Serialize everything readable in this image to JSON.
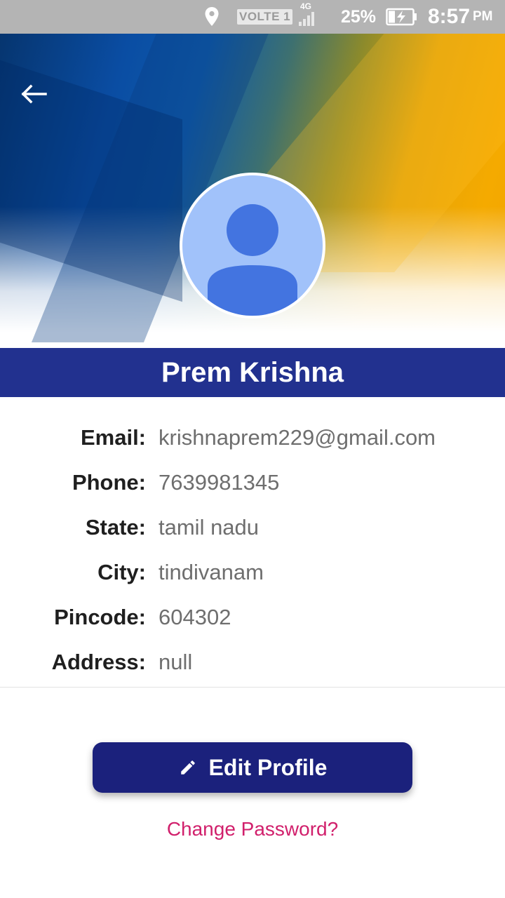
{
  "status_bar": {
    "network_badge": "VOLTE 1",
    "network_type": "4G",
    "battery_percent": "25%",
    "time": "8:57",
    "ampm": "PM"
  },
  "profile": {
    "name": "Prem Krishna"
  },
  "details": [
    {
      "label": "Email:",
      "value": "krishnaprem229@gmail.com"
    },
    {
      "label": "Phone:",
      "value": "7639981345"
    },
    {
      "label": "State:",
      "value": "tamil nadu"
    },
    {
      "label": "City:",
      "value": "tindivanam"
    },
    {
      "label": "Pincode:",
      "value": "604302"
    },
    {
      "label": "Address:",
      "value": "null"
    }
  ],
  "actions": {
    "edit_label": "Edit Profile",
    "change_password_label": "Change Password?"
  },
  "icons": {
    "back": "arrow-left-icon",
    "edit": "pencil-icon",
    "location": "location-pin-icon",
    "signal": "signal-icon",
    "battery": "battery-charging-icon",
    "avatar": "user-avatar-icon"
  },
  "colors": {
    "status_bar": "#b4b4b4",
    "name_bar": "#22318f",
    "edit_button": "#1b217c",
    "link": "#d1206c",
    "avatar_bg": "#a1c2fa",
    "avatar_fg": "#4374e0"
  }
}
